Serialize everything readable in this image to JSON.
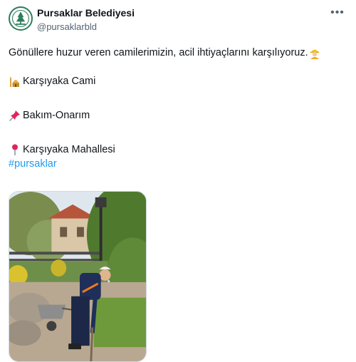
{
  "account": {
    "display_name": "Pursaklar Belediyesi",
    "handle": "@pursaklarbld"
  },
  "post": {
    "text_line1": "Gönüllere huzur veren camilerimizin, acil ihtiyaçlarını karşılıyoruz.",
    "text_line2": "Karşıyaka Cami",
    "text_line3": "Bakım-Onarım",
    "text_line4": "Karşıyaka Mahallesi",
    "hashtag": "#pursaklar"
  },
  "icons": {
    "avatar": "municipality-logo-icon",
    "more": "more-horizontal-icon",
    "worker": "construction-worker-emoji",
    "mosque": "mosque-emoji",
    "pushpin": "pushpin-emoji",
    "location": "round-pushpin-emoji"
  },
  "colors": {
    "link": "#1d9bf0",
    "secondary_text": "#536471",
    "logo_green": "#2e7d5b"
  }
}
